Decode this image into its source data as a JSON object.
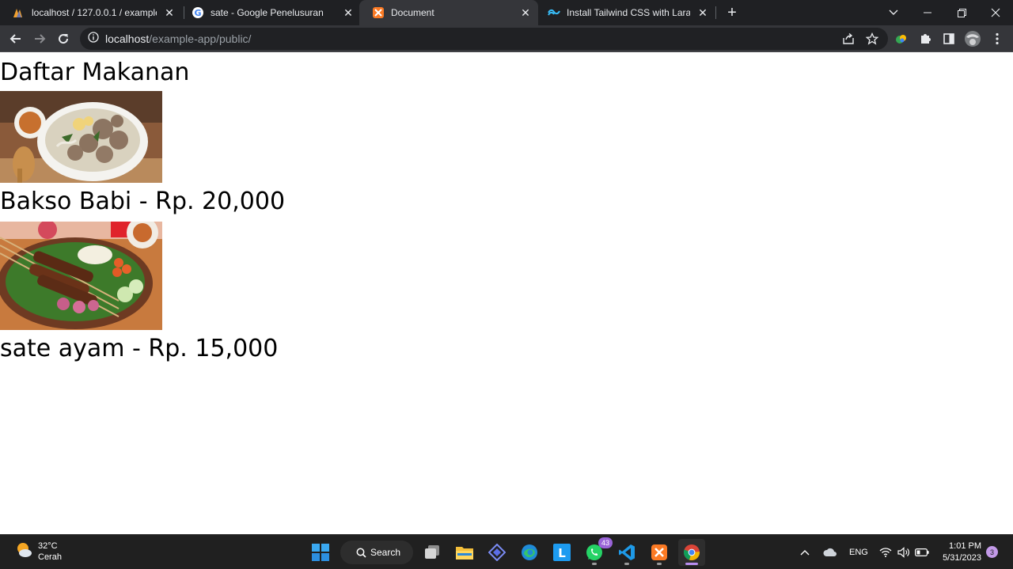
{
  "tabs": [
    {
      "title": "localhost / 127.0.0.1 / example_a",
      "icon": "phpmyadmin-icon"
    },
    {
      "title": "sate - Google Penelusuran",
      "icon": "google-icon"
    },
    {
      "title": "Document",
      "icon": "xampp-icon"
    },
    {
      "title": "Install Tailwind CSS with Laravel -",
      "icon": "tailwind-icon"
    }
  ],
  "address_bar": {
    "host": "localhost",
    "path": "/example-app/public/"
  },
  "page": {
    "heading": "Daftar Makanan",
    "items": [
      {
        "caption": "Bakso Babi - Rp. 20,000"
      },
      {
        "caption": "sate ayam - Rp. 15,000"
      }
    ]
  },
  "taskbar": {
    "weather": {
      "temp": "32°C",
      "condition": "Cerah"
    },
    "search_label": "Search",
    "whatsapp_badge": "43",
    "language": "ENG",
    "time": "1:01 PM",
    "date": "5/31/2023",
    "notification_count": "3"
  },
  "colors": {
    "tabbar_bg": "#1f2023",
    "active_tab_bg": "#35363a",
    "omnibox_bg": "#202124",
    "taskbar_bg": "#202020"
  }
}
